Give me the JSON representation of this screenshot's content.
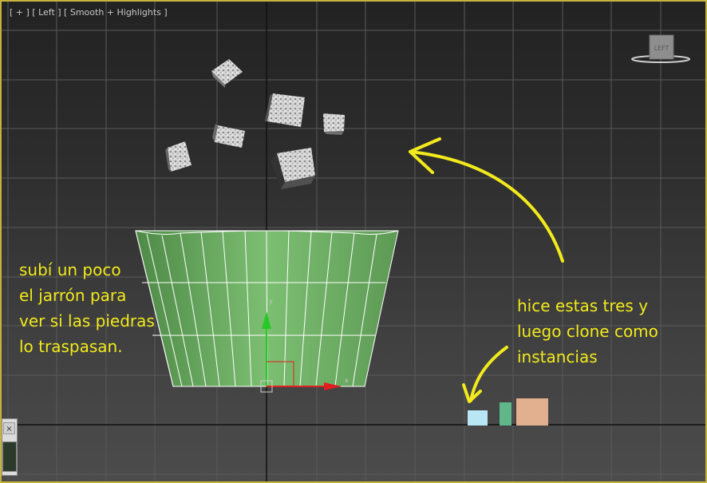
{
  "viewport": {
    "label": "[ + ] [ Left ] [ Smooth + Highlights ]",
    "viewcube_label": "LEFT",
    "axis_y_label": "y",
    "axis_x_label": "x"
  },
  "annotations": {
    "left_note": [
      "subí un poco",
      "el jarrón para",
      "ver si las piedras",
      "lo traspasan."
    ],
    "right_note": [
      "hice estas tres y",
      "luego clone como",
      "instancias"
    ]
  },
  "mini_panel": {
    "close_label": "×"
  },
  "colors": {
    "annotation": "#f2ea1c",
    "vase": "#6aa862",
    "box_blue": "#b8e6f4",
    "box_green": "#5fb78a",
    "box_peach": "#e2b08e",
    "active_border": "#c7b23a"
  },
  "icons": {
    "arrow_to_stones": "curved-arrow-icon",
    "arrow_to_boxes": "curved-arrow-icon",
    "viewcube": "viewcube-icon"
  }
}
